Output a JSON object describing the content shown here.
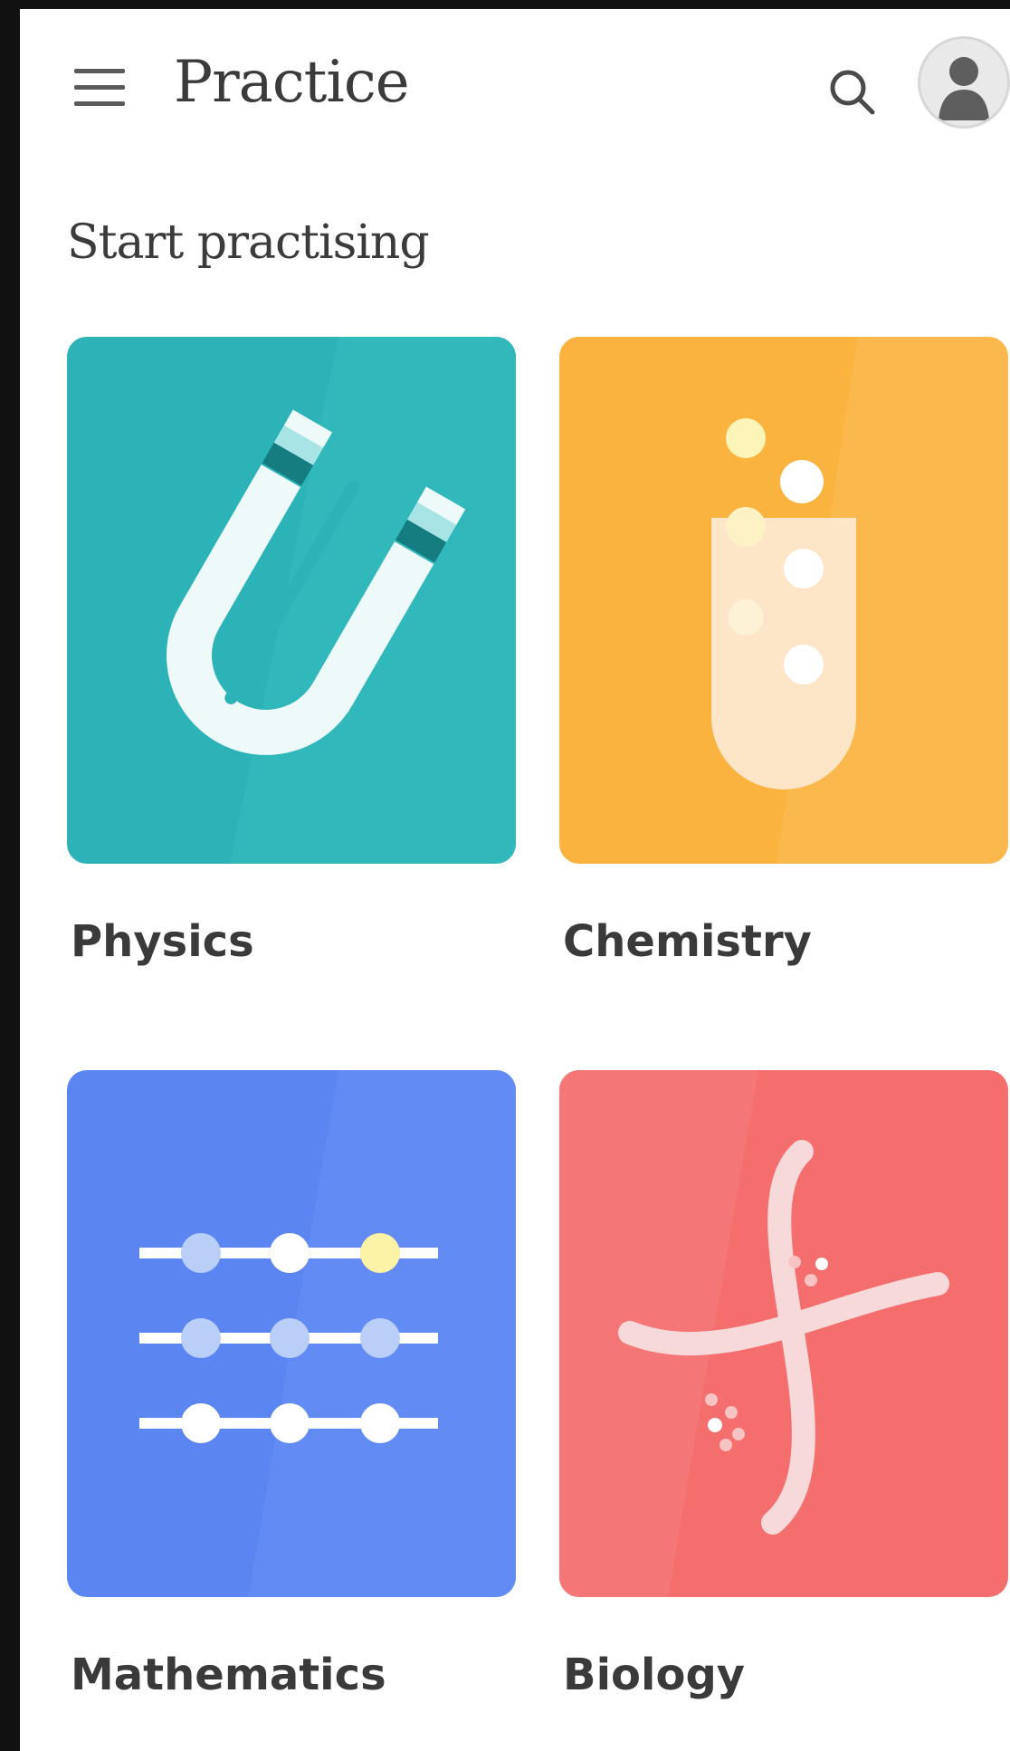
{
  "app_bar": {
    "title": "Practice",
    "menu_icon": "hamburger-menu-icon",
    "search_icon": "search-icon",
    "avatar_icon": "user-avatar-icon"
  },
  "section": {
    "title": "Start practising"
  },
  "subjects": [
    {
      "label": "Physics",
      "color": "#2bb3b7",
      "icon": "magnet-icon"
    },
    {
      "label": "Chemistry",
      "color": "#fbb340",
      "icon": "test-tube-icon"
    },
    {
      "label": "Mathematics",
      "color": "#5b86f2",
      "icon": "abacus-icon"
    },
    {
      "label": "Biology",
      "color": "#f46e6e",
      "icon": "chromosome-icon"
    }
  ]
}
